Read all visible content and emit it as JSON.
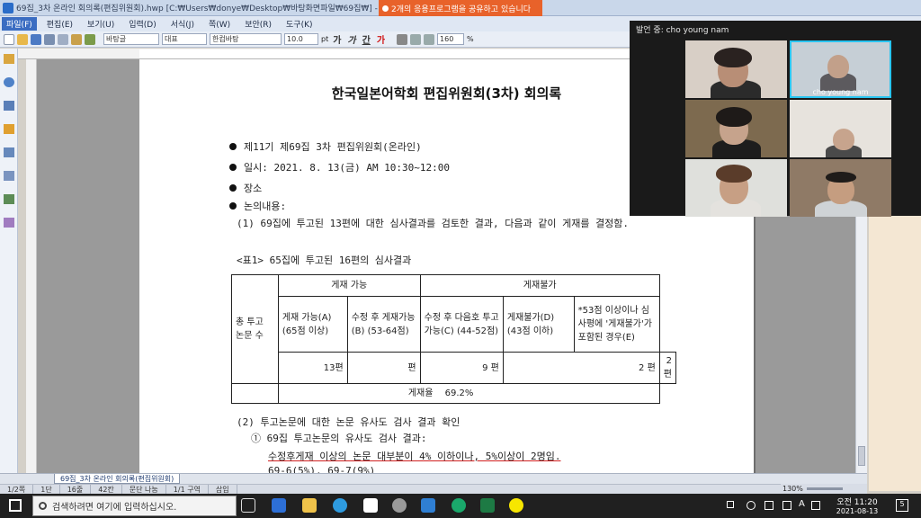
{
  "window": {
    "title": "69집_3차 온라인 회의록(편집위원회).hwp [C:₩Users₩donye₩Desktop₩바탕화면파일₩69집₩] - 한컴오피스",
    "share_banner": "2개의 응용프로그램을 공유하고 있습니다"
  },
  "menu": [
    "파일(F)",
    "편집(E)",
    "보기(U)",
    "입력(D)",
    "서식(J)",
    "쪽(W)",
    "보안(R)",
    "도구(K)"
  ],
  "toolbar": {
    "style": "바탕글",
    "lang": "대표",
    "font": "한컴바탕",
    "size": "10.0",
    "size_unit": "pt",
    "fmt_bold": "가",
    "fmt_italic": "가",
    "fmt_underline": "간",
    "fmt_color": "가",
    "zoom": "160",
    "zoom_unit": "%"
  },
  "document": {
    "title": "한국일본어학회 편집위원회(3차) 회의록",
    "bullets": [
      "제11기 제69집 3차 편집위원회(온라인)",
      "일시: 2021. 8. 13(금) AM 10:30~12:00",
      "장소",
      "논의내용:"
    ],
    "item1": "(1) 69집에 투고된 13편에 대한 심사결과를 검토한 결과, 다음과 같이 게재를 결정함.",
    "table_caption": "<표1> 65집에 투고된 16편의 심사결과",
    "table": {
      "h_total": "총 투고 논문 수",
      "h_accept": "게재 가능",
      "h_reject": "게재불가",
      "c_a": "게재 가능(A) (65점 이상)",
      "c_b": "수정 후 게재가능(B) (53-64점)",
      "c_c": "수정 후 다음호 투고 가능(C) (44-52점)",
      "c_d": "게재불가(D) (43점 이하)",
      "c_e": "*53점 이상이나 심사평에 '게재불가'가 포함된 경우(E)",
      "v_total": "13편",
      "v_a": "편",
      "v_b": "9 편",
      "v_c": "2 편",
      "v_e": "2 편",
      "rate_label": "게재율",
      "rate_value": "69.2%"
    },
    "item2": "(2) 투고논문에 대한 논문 유사도 검사 결과 확인",
    "item2_1": "① 69집 투고논문의 유사도 검사 결과:",
    "item2_1a": "수정후게재 이상의 논문 대부분이 4% 이하이나, 5%이상이 2명임.",
    "item2_1b": "69-6(5%), 69-7(9%)"
  },
  "tabs": {
    "active": "69집_3차 온라인 회의록(편집위원회)"
  },
  "status": [
    "1/2쪽",
    "1단",
    "16줄",
    "42칸",
    "문단 나눔",
    "1/1 구역",
    "삽입"
  ],
  "status_zoom": "130%",
  "zoom_panel": {
    "speaker_label": "발언 중: cho young nam",
    "active_name": "cho young nam"
  },
  "taskbar": {
    "search_placeholder": "검색하려면 여기에 입력하십시오.",
    "time": "오전 11:20",
    "date": "2021-08-13",
    "lang": "A",
    "notify_count": "5"
  }
}
